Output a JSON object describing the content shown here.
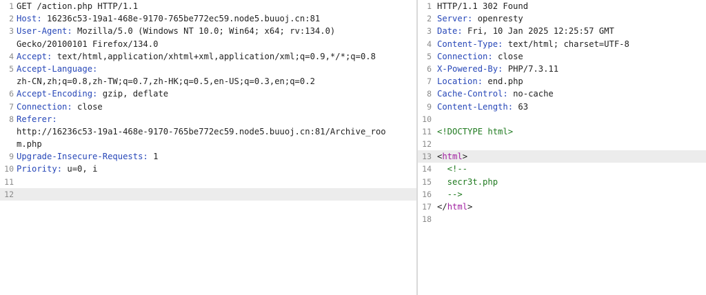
{
  "request": {
    "lines": [
      {
        "n": "1",
        "k": "",
        "v": "GET /action.php HTTP/1.1"
      },
      {
        "n": "2",
        "k": "Host:",
        "v": " 16236c53-19a1-468e-9170-765be772ec59.node5.buuoj.cn:81"
      },
      {
        "n": "3",
        "k": "User-Agent:",
        "v": " Mozilla/5.0 (Windows NT 10.0; Win64; x64; rv:134.0)"
      },
      {
        "n": "",
        "k": "",
        "v": "Gecko/20100101 Firefox/134.0"
      },
      {
        "n": "4",
        "k": "Accept:",
        "v": " text/html,application/xhtml+xml,application/xml;q=0.9,*/*;q=0.8"
      },
      {
        "n": "5",
        "k": "Accept-Language:",
        "v": ""
      },
      {
        "n": "",
        "k": "",
        "v": "zh-CN,zh;q=0.8,zh-TW;q=0.7,zh-HK;q=0.5,en-US;q=0.3,en;q=0.2"
      },
      {
        "n": "6",
        "k": "Accept-Encoding:",
        "v": " gzip, deflate"
      },
      {
        "n": "7",
        "k": "Connection:",
        "v": " close"
      },
      {
        "n": "8",
        "k": "Referer:",
        "v": ""
      },
      {
        "n": "",
        "k": "",
        "v": "http://16236c53-19a1-468e-9170-765be772ec59.node5.buuoj.cn:81/Archive_roo"
      },
      {
        "n": "",
        "k": "",
        "v": "m.php"
      },
      {
        "n": "9",
        "k": "Upgrade-Insecure-Requests:",
        "v": " 1"
      },
      {
        "n": "10",
        "k": "Priority:",
        "v": " u=0, i"
      },
      {
        "n": "11",
        "k": "",
        "v": ""
      },
      {
        "n": "12",
        "k": "",
        "v": ""
      }
    ]
  },
  "response": {
    "lines": [
      {
        "n": "1",
        "k": "",
        "v": "HTTP/1.1 302 Found"
      },
      {
        "n": "2",
        "k": "Server:",
        "v": " openresty"
      },
      {
        "n": "3",
        "k": "Date:",
        "v": " Fri, 10 Jan 2025 12:25:57 GMT"
      },
      {
        "n": "4",
        "k": "Content-Type:",
        "v": " text/html; charset=UTF-8"
      },
      {
        "n": "5",
        "k": "Connection:",
        "v": " close"
      },
      {
        "n": "6",
        "k": "X-Powered-By:",
        "v": " PHP/7.3.11"
      },
      {
        "n": "7",
        "k": "Location:",
        "v": " end.php"
      },
      {
        "n": "8",
        "k": "Cache-Control:",
        "v": " no-cache"
      },
      {
        "n": "9",
        "k": "Content-Length:",
        "v": " 63"
      },
      {
        "n": "10",
        "k": "",
        "v": ""
      },
      {
        "n": "11",
        "k": "",
        "v": "<!DOCTYPE html>"
      },
      {
        "n": "12",
        "k": "",
        "v": ""
      },
      {
        "n": "13",
        "k": "",
        "v": "<html>"
      },
      {
        "n": "14",
        "k": "",
        "v": "  <!--"
      },
      {
        "n": "15",
        "k": "",
        "v": "  secr3t.php"
      },
      {
        "n": "16",
        "k": "",
        "v": "  -->"
      },
      {
        "n": "17",
        "k": "",
        "v": "</html>"
      },
      {
        "n": "18",
        "k": "",
        "v": ""
      }
    ]
  }
}
